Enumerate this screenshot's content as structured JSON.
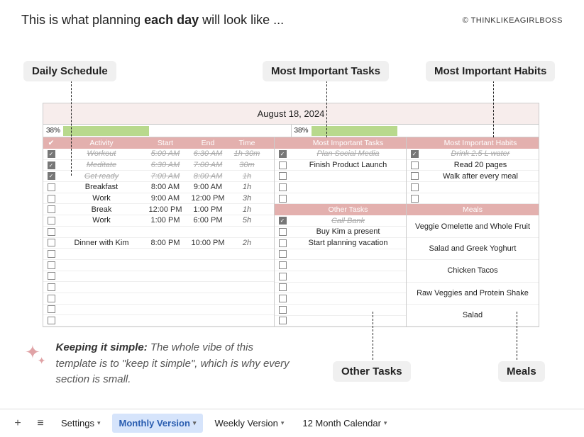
{
  "header": {
    "title_pre": "This is what planning ",
    "title_bold": "each day",
    "title_post": " will look like ...",
    "copyright": "© THINKLIKEAGIRLBOSS"
  },
  "callouts": {
    "daily": "Daily Schedule",
    "tasks": "Most Important Tasks",
    "habits": "Most Important Habits",
    "other": "Other Tasks",
    "meals": "Meals"
  },
  "sheet": {
    "date": "August 18, 2024",
    "progress_left_pct": "38%",
    "progress_right_pct": "38%",
    "progress_fill": 38,
    "headers": {
      "activity": "Activity",
      "start": "Start",
      "end": "End",
      "time": "Time",
      "mit": "Most Important Tasks",
      "mih": "Most Important Habits",
      "other": "Other Tasks",
      "meals": "Meals",
      "check": "✔"
    },
    "schedule": [
      {
        "checked": true,
        "act": "Workout",
        "start": "5:00 AM",
        "end": "6:30 AM",
        "dur": "1h 30m",
        "done": true
      },
      {
        "checked": true,
        "act": "Meditate",
        "start": "6:30 AM",
        "end": "7:00 AM",
        "dur": "30m",
        "done": true
      },
      {
        "checked": true,
        "act": "Get ready",
        "start": "7:00 AM",
        "end": "8:00 AM",
        "dur": "1h",
        "done": true
      },
      {
        "checked": false,
        "act": "Breakfast",
        "start": "8:00 AM",
        "end": "9:00 AM",
        "dur": "1h",
        "done": false
      },
      {
        "checked": false,
        "act": "Work",
        "start": "9:00 AM",
        "end": "12:00 PM",
        "dur": "3h",
        "done": false
      },
      {
        "checked": false,
        "act": "Break",
        "start": "12:00 PM",
        "end": "1:00 PM",
        "dur": "1h",
        "done": false
      },
      {
        "checked": false,
        "act": "Work",
        "start": "1:00 PM",
        "end": "6:00 PM",
        "dur": "5h",
        "done": false
      },
      {
        "checked": false,
        "act": "",
        "start": "",
        "end": "",
        "dur": "",
        "done": false
      },
      {
        "checked": false,
        "act": "Dinner with Kim",
        "start": "8:00 PM",
        "end": "10:00 PM",
        "dur": "2h",
        "done": false
      },
      {
        "checked": false,
        "act": "",
        "start": "",
        "end": "",
        "dur": "",
        "done": false
      },
      {
        "checked": false,
        "act": "",
        "start": "",
        "end": "",
        "dur": "",
        "done": false
      },
      {
        "checked": false,
        "act": "",
        "start": "",
        "end": "",
        "dur": "",
        "done": false
      },
      {
        "checked": false,
        "act": "",
        "start": "",
        "end": "",
        "dur": "",
        "done": false
      },
      {
        "checked": false,
        "act": "",
        "start": "",
        "end": "",
        "dur": "",
        "done": false
      },
      {
        "checked": false,
        "act": "",
        "start": "",
        "end": "",
        "dur": "",
        "done": false
      },
      {
        "checked": false,
        "act": "",
        "start": "",
        "end": "",
        "dur": "",
        "done": false
      }
    ],
    "mit": [
      {
        "checked": true,
        "text": "Plan Social Media",
        "done": true
      },
      {
        "checked": false,
        "text": "Finish Product Launch",
        "done": false
      },
      {
        "checked": false,
        "text": "",
        "done": false
      },
      {
        "checked": false,
        "text": "",
        "done": false
      },
      {
        "checked": false,
        "text": "",
        "done": false
      }
    ],
    "mih": [
      {
        "checked": true,
        "text": "Drink 2.5 L water",
        "done": true
      },
      {
        "checked": false,
        "text": "Read 20 pages",
        "done": false
      },
      {
        "checked": false,
        "text": "Walk after every meal",
        "done": false
      },
      {
        "checked": false,
        "text": "",
        "done": false
      },
      {
        "checked": false,
        "text": "",
        "done": false
      }
    ],
    "other": [
      {
        "checked": true,
        "text": "Call Bank",
        "done": true
      },
      {
        "checked": false,
        "text": "Buy Kim a present",
        "done": false
      },
      {
        "checked": false,
        "text": "Start planning vacation",
        "done": false
      },
      {
        "checked": false,
        "text": "",
        "done": false
      },
      {
        "checked": false,
        "text": "",
        "done": false
      },
      {
        "checked": false,
        "text": "",
        "done": false
      },
      {
        "checked": false,
        "text": "",
        "done": false
      },
      {
        "checked": false,
        "text": "",
        "done": false
      },
      {
        "checked": false,
        "text": "",
        "done": false
      },
      {
        "checked": false,
        "text": "",
        "done": false
      }
    ],
    "meals": [
      "Veggie Omelette and Whole Fruit",
      "Salad and Greek Yoghurt",
      "Chicken Tacos",
      "Raw Veggies and Protein Shake",
      "Salad"
    ]
  },
  "note": {
    "bold": "Keeping it simple:",
    "text": " The whole vibe of this template is to \"keep it simple\", which is why every section is small."
  },
  "bottom": {
    "settings": "Settings",
    "monthly": "Monthly Version",
    "weekly": "Weekly Version",
    "cal": "12 Month Calendar"
  }
}
